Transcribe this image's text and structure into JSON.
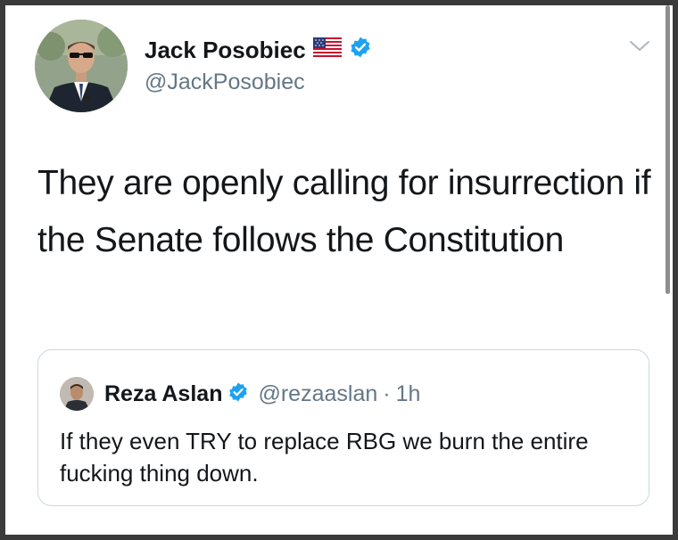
{
  "tweet": {
    "author": {
      "display_name": "Jack Posobiec",
      "handle": "@JackPosobiec",
      "flag_icon": "us-flag-icon",
      "verified_icon": "verified-badge-icon"
    },
    "menu_icon": "chevron-down-icon",
    "text": "They are openly calling for insurrection if the Senate follows the Constitution"
  },
  "quoted_tweet": {
    "author": {
      "display_name": "Reza Aslan",
      "handle": "@rezaaslan",
      "verified_icon": "verified-badge-icon"
    },
    "separator": "·",
    "time": "1h",
    "text": "If they even TRY to replace RBG we burn the entire fucking thing down."
  },
  "colors": {
    "verified_blue": "#1da1f2",
    "text_primary": "#14171a",
    "text_secondary": "#657786",
    "border": "#ccd6dd"
  }
}
